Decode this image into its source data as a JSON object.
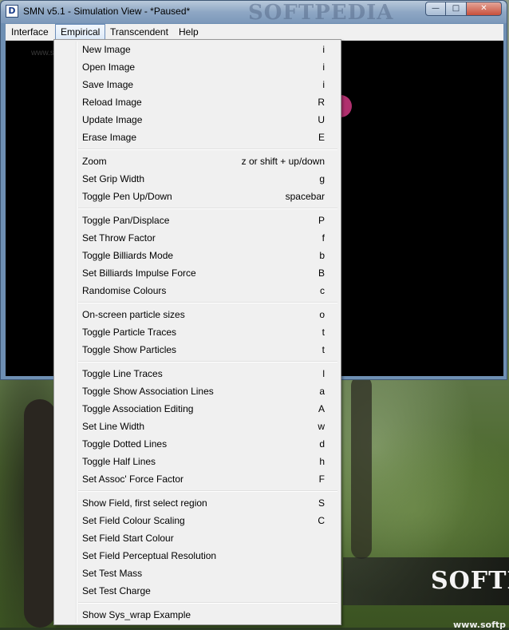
{
  "window": {
    "title": "SMN v5.1 - Simulation View - *Paused*",
    "app_icon_glyph": "D",
    "watermark": "SOFTPEDIA",
    "canvas_watermark": "www.softpedia",
    "buttons": {
      "minimize": "—",
      "maximize": "□",
      "close": "✕"
    }
  },
  "menubar": [
    "Interface",
    "Empirical",
    "Transcendent",
    "Help"
  ],
  "menubar_active": "Empirical",
  "dropdown": {
    "groups": [
      [
        {
          "label": "New Image",
          "shortcut": "i"
        },
        {
          "label": "Open Image",
          "shortcut": "i"
        },
        {
          "label": "Save Image",
          "shortcut": "i"
        },
        {
          "label": "Reload Image",
          "shortcut": "R"
        },
        {
          "label": "Update Image",
          "shortcut": "U"
        },
        {
          "label": "Erase Image",
          "shortcut": "E"
        }
      ],
      [
        {
          "label": "Zoom",
          "shortcut": "z or shift + up/down"
        },
        {
          "label": "Set Grip Width",
          "shortcut": "g"
        },
        {
          "label": "Toggle Pen Up/Down",
          "shortcut": "spacebar"
        }
      ],
      [
        {
          "label": "Toggle Pan/Displace",
          "shortcut": "P"
        },
        {
          "label": "Set Throw Factor",
          "shortcut": "f"
        },
        {
          "label": "Toggle Billiards Mode",
          "shortcut": "b"
        },
        {
          "label": "Set Billiards Impulse Force",
          "shortcut": "B"
        },
        {
          "label": "Randomise Colours",
          "shortcut": "c"
        }
      ],
      [
        {
          "label": "On-screen particle sizes",
          "shortcut": "o"
        },
        {
          "label": "Toggle Particle Traces",
          "shortcut": "t"
        },
        {
          "label": "Toggle Show Particles",
          "shortcut": "t"
        }
      ],
      [
        {
          "label": "Toggle Line Traces",
          "shortcut": "l"
        },
        {
          "label": "Toggle Show Association Lines",
          "shortcut": "a"
        },
        {
          "label": "Toggle Association Editing",
          "shortcut": "A"
        },
        {
          "label": "Set Line Width",
          "shortcut": "w"
        },
        {
          "label": "Toggle Dotted Lines",
          "shortcut": "d"
        },
        {
          "label": "Toggle Half Lines",
          "shortcut": "h"
        },
        {
          "label": "Set Assoc' Force Factor",
          "shortcut": "F"
        }
      ],
      [
        {
          "label": "Show Field, first select region",
          "shortcut": "S"
        },
        {
          "label": "Set Field Colour Scaling",
          "shortcut": "C"
        },
        {
          "label": "Set Field Start Colour",
          "shortcut": ""
        },
        {
          "label": "Set Field Perceptual Resolution",
          "shortcut": ""
        },
        {
          "label": "Set Test Mass",
          "shortcut": ""
        },
        {
          "label": "Set Test Charge",
          "shortcut": ""
        }
      ],
      [
        {
          "label": "Show Sys_wrap Example",
          "shortcut": ""
        }
      ]
    ]
  },
  "wallpaper": {
    "brand": "SOFTP",
    "url": "www.softp"
  }
}
